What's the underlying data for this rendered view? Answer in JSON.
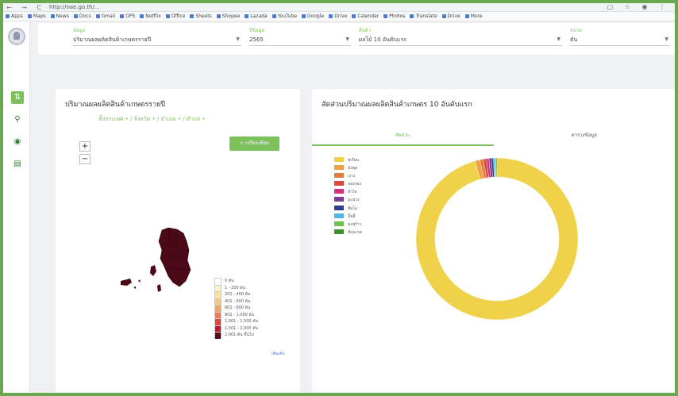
{
  "browser": {
    "url": "http://oae.go.th/...",
    "nav": "← → C",
    "window_buttons": "▢ ☆ ◉ ⋮",
    "bookmarks": [
      "Apps",
      "Maps",
      "News",
      "Docs",
      "Gmail",
      "OPS",
      "Netflix",
      "Office",
      "Sheets",
      "Shopee",
      "Lazada",
      "YouTube",
      "Google",
      "Drive",
      "Calendar",
      "Photos",
      "Translate",
      "Drive",
      "More"
    ]
  },
  "filters": [
    {
      "label": "ข้อมูล",
      "value": "ปริมาณผลผลิตสินค้าเกษตรรายปี"
    },
    {
      "label": "ปีข้อมูล",
      "value": "2565"
    },
    {
      "label": "สินค้า",
      "value": "ผลไม้ 10 อันดับแรก"
    },
    {
      "label": "หน่วย",
      "value": "ตัน"
    }
  ],
  "map_card": {
    "title": "ปริมาณผลผลิตสินค้าเกษตรรายปี",
    "breadcrumb": "ทั้งประเทศ • / จังหวัด • / อำเภอ • / ตำบล •",
    "zoom_in": "+",
    "zoom_out": "−",
    "compare_button": "+ เปรียบเทียบ",
    "more_link": "เพิ่มเติม"
  },
  "map_legend": [
    {
      "label": "0 ตัน",
      "color": "#ffffff"
    },
    {
      "label": "1 - 200 ตัน",
      "color": "#fff2c4"
    },
    {
      "label": "201 - 400 ตัน",
      "color": "#fde39a"
    },
    {
      "label": "401 - 600 ตัน",
      "color": "#f9c77a"
    },
    {
      "label": "601 - 800 ตัน",
      "color": "#f4a35e"
    },
    {
      "label": "801 - 1,000 ตัน",
      "color": "#ef7b4b"
    },
    {
      "label": "1,001 - 1,500 ตัน",
      "color": "#e3483c"
    },
    {
      "label": "1,501 - 2,000 ตัน",
      "color": "#c0162e"
    },
    {
      "label": "2,001 ตัน ขึ้นไป",
      "color": "#5a0a1b"
    }
  ],
  "pie_card": {
    "title": "สัดส่วนปริมาณผลผลิตสินค้าเกษตร 10 อันดับแรก",
    "tabs": [
      "สัดส่วน",
      "ตารางข้อมูล"
    ],
    "active_tab": 0
  },
  "chart_data": {
    "type": "pie",
    "donut": true,
    "title": "สัดส่วนปริมาณผลผลิตสินค้าเกษตร 10 อันดับแรก",
    "categories": [
      "ทุเรียน",
      "มังคุด",
      "เงาะ",
      "ลองกอง",
      "ลำไย",
      "มะม่วง",
      "ส้มโอ",
      "ลิ้นจี่",
      "มะพร้าว",
      "สับปะรด"
    ],
    "values": [
      95.6,
      1.0,
      0.7,
      0.6,
      0.5,
      0.5,
      0.4,
      0.3,
      0.2,
      0.2
    ],
    "colors": [
      "#efd24a",
      "#f0a046",
      "#e07b39",
      "#d9493c",
      "#d6317a",
      "#7a3d8f",
      "#2e3d8f",
      "#52b5e8",
      "#6cc24a",
      "#3f8f2c"
    ]
  }
}
